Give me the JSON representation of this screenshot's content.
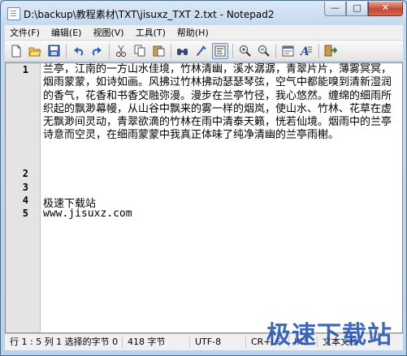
{
  "window": {
    "title": "D:\\backup\\教程素材\\TXT\\jisuxz_TXT 2.txt - Notepad2",
    "min_glyph": "—",
    "max_glyph": "□",
    "close_glyph": "✕"
  },
  "menu": [
    "文件(F)",
    "编辑(E)",
    "视图(V)",
    "工具(T)",
    "帮助(H)"
  ],
  "toolbar": {
    "buttons": [
      "new-icon",
      "open-icon",
      "save-icon",
      "undo-icon",
      "redo-icon",
      "cut-icon",
      "copy-icon",
      "paste-icon",
      "find-icon",
      "replace-icon",
      "word-wrap-icon",
      "zoom-in-icon",
      "zoom-out-icon",
      "schemes-icon",
      "font-icon",
      "exit-icon"
    ],
    "active": "word-wrap-icon"
  },
  "editor": {
    "line_numbers": [
      "1",
      "2",
      "3",
      "4",
      "5"
    ],
    "line1": "兰亭，江南的一方山水佳境，竹林清幽，溪水潺潺，青翠片片，薄雾冥冥，烟雨蒙蒙，如诗如画。风拂过竹林拂动瑟瑟琴弦，空气中都能嗅到清新湿润的香气，花香和书香交融弥漫。漫步在兰亭竹径，我心悠然。缠绵的细雨所织起的飘渺幕幔，从山谷中飘来的雾一样的烟岚，使山水、竹林、花草在虚无飘渺间灵动，青翠欲滴的竹林在雨中清泰天籁，恍若仙境。烟雨中的兰亭诗意而空灵，在细雨蒙蒙中我真正体味了纯净清幽的兰亭雨榭。",
    "line2": "",
    "line3": "",
    "line4": "极速下载站",
    "line5": "www.jisuxz.com"
  },
  "status": {
    "position": "行 1 : 5   列 1   选择的字节 0",
    "bytes": "418 字节",
    "encoding": "UTF-8",
    "eol": "CR+LF",
    "ins": "INS",
    "mode": "文本文档"
  },
  "watermark": "极速下载站"
}
